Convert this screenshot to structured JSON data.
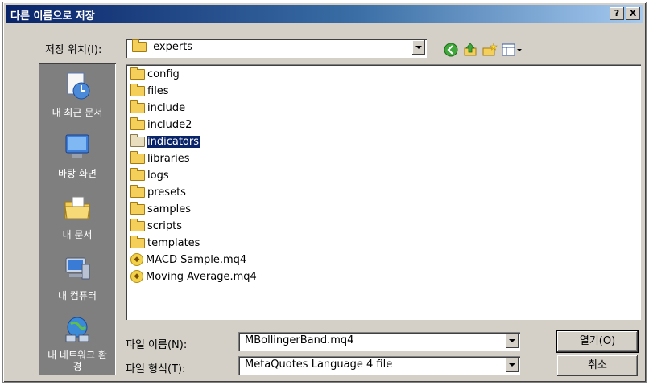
{
  "window": {
    "title": "다른 이름으로 저장",
    "help_label": "?",
    "close_label": "X"
  },
  "location": {
    "label": "저장 위치(I):",
    "value": "experts"
  },
  "toolbar": {
    "icons": [
      "back-icon",
      "up-folder-icon",
      "new-folder-icon",
      "view-menu-icon"
    ]
  },
  "sidebar": {
    "items": [
      {
        "label": "내 최근 문서",
        "icon": "recent-documents-icon"
      },
      {
        "label": "바탕 화면",
        "icon": "desktop-icon"
      },
      {
        "label": "내 문서",
        "icon": "my-documents-icon"
      },
      {
        "label": "내 컴퓨터",
        "icon": "my-computer-icon"
      },
      {
        "label": "내 네트워크 환경",
        "icon": "network-places-icon"
      }
    ]
  },
  "files": [
    {
      "name": "config",
      "type": "folder"
    },
    {
      "name": "files",
      "type": "folder"
    },
    {
      "name": "include",
      "type": "folder"
    },
    {
      "name": "include2",
      "type": "folder"
    },
    {
      "name": "indicators",
      "type": "folder",
      "selected": true
    },
    {
      "name": "libraries",
      "type": "folder"
    },
    {
      "name": "logs",
      "type": "folder"
    },
    {
      "name": "presets",
      "type": "folder"
    },
    {
      "name": "samples",
      "type": "folder"
    },
    {
      "name": "scripts",
      "type": "folder"
    },
    {
      "name": "templates",
      "type": "folder"
    },
    {
      "name": "MACD Sample.mq4",
      "type": "mq4"
    },
    {
      "name": "Moving Average.mq4",
      "type": "mq4"
    }
  ],
  "filename": {
    "label": "파일 이름(N):",
    "value": "MBollingerBand.mq4"
  },
  "filetype": {
    "label": "파일 형식(T):",
    "value": "MetaQuotes Language 4 file"
  },
  "buttons": {
    "open": "열기(O)",
    "cancel": "취소"
  },
  "colors": {
    "title_bar": "#0a246a",
    "selection": "#0a246a",
    "dialog_face": "#d4d0c8",
    "places_bar": "#7f7f7f"
  }
}
